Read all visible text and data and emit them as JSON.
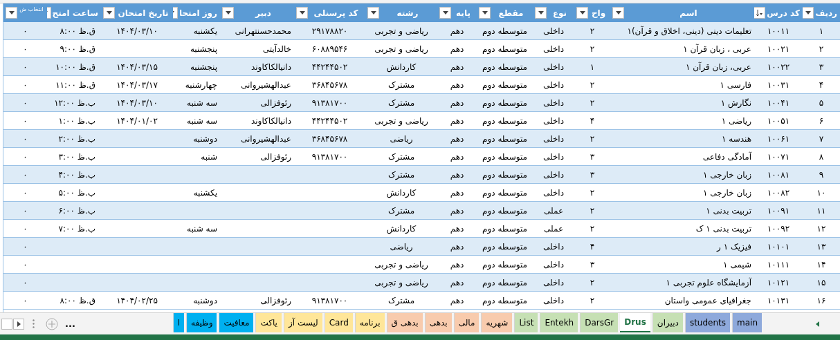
{
  "table": {
    "columns": [
      {
        "label": "ردیف",
        "sorted": false
      },
      {
        "label": "کد درس",
        "sorted": true
      },
      {
        "label": "اسم",
        "sorted": false
      },
      {
        "label": "واح",
        "sorted": false
      },
      {
        "label": "نوع",
        "sorted": false
      },
      {
        "label": "مقطع",
        "sorted": false
      },
      {
        "label": "پایه",
        "sorted": false
      },
      {
        "label": "رشته",
        "sorted": false
      },
      {
        "label": "کد پرسنلی",
        "sorted": false
      },
      {
        "label": "دبیر",
        "sorted": false
      },
      {
        "label": "روز امتحا",
        "sorted": false
      },
      {
        "label": "تاریخ امتحان",
        "sorted": false
      },
      {
        "label": "ساعت امتح",
        "sorted": false
      },
      {
        "label": "انتخاب ش",
        "sorted": false
      }
    ],
    "rows": [
      [
        "۱",
        "۱۰۰۱۱",
        "تعلیمات دینی (دینی، اخلاق و قرآن)۱",
        "۲",
        "داخلی",
        "متوسطه دوم",
        "دهم",
        "ریاضی و تجربی",
        "۲۹۱۷۸۸۲۰",
        "محمدحسنتهرانی",
        "یکشنبه",
        "۱۴۰۴/۰۳/۱۰",
        "ق.ظ ۸:۰۰",
        "۰"
      ],
      [
        "۲",
        "۱۰۰۲۱",
        "عربی ، زبان قرآن ۱",
        "۲",
        "داخلی",
        "متوسطه دوم",
        "دهم",
        "ریاضی و تجربی",
        "۶۰۸۸۹۵۴۶",
        "خالدآیتی",
        "پنجشنبه",
        null,
        "ق.ظ ۹:۰۰",
        "۰"
      ],
      [
        "۳",
        "۱۰۰۲۲",
        "عربی، زبان قرآن ۱",
        "۱",
        "داخلی",
        "متوسطه دوم",
        "دهم",
        "کاردانش",
        "۴۴۲۴۴۵۰۲",
        "دانیالکاکاوند",
        "پنجشنبه",
        "۱۴۰۴/۰۳/۱۵",
        "ق.ظ ۱۰:۰۰",
        "۰"
      ],
      [
        "۴",
        "۱۰۰۳۱",
        "فارسی ۱",
        "۲",
        "داخلی",
        "متوسطه دوم",
        "دهم",
        "مشترک",
        "۳۶۸۴۵۶۷۸",
        "عبدالهشیروانی",
        "چهارشنبه",
        "۱۴۰۴/۰۳/۱۷",
        "ق.ظ ۱۱:۰۰",
        "۰"
      ],
      [
        "۵",
        "۱۰۰۴۱",
        "نگارش ۱",
        "۲",
        "داخلی",
        "متوسطه دوم",
        "دهم",
        "مشترک",
        "۹۱۳۸۱۷۰۰",
        "رئوفزالی",
        "سه شنبه",
        "۱۴۰۴/۰۳/۱۰",
        "ب.ظ ۱۲:۰۰",
        "۰"
      ],
      [
        "۶",
        "۱۰۰۵۱",
        "ریاضی ۱",
        "۴",
        "داخلی",
        "متوسطه دوم",
        "دهم",
        "ریاضی و تجربی",
        "۴۴۲۴۴۵۰۲",
        "دانیالکاکاوند",
        "سه شنبه",
        "۱۴۰۴/۰۱/۰۲",
        "ب.ظ ۱:۰۰",
        "۰"
      ],
      [
        "۷",
        "۱۰۰۶۱",
        "هندسه ۱",
        "۲",
        "داخلی",
        "متوسطه دوم",
        "دهم",
        "ریاضی",
        "۳۶۸۴۵۶۷۸",
        "عبدالهشیروانی",
        "دوشنبه",
        null,
        "ب.ظ ۲:۰۰",
        "۰"
      ],
      [
        "۸",
        "۱۰۰۷۱",
        "آمادگی دفاعی",
        "۳",
        "داخلی",
        "متوسطه دوم",
        "دهم",
        "مشترک",
        "۹۱۳۸۱۷۰۰",
        "رئوفزالی",
        "شنبه",
        null,
        "ب.ظ ۳:۰۰",
        "۰"
      ],
      [
        "۹",
        "۱۰۰۸۱",
        "زبان خارجی ۱",
        "۳",
        "داخلی",
        "متوسطه دوم",
        "دهم",
        "مشترک",
        null,
        null,
        null,
        null,
        "ب.ظ ۴:۰۰",
        "۰"
      ],
      [
        "۱۰",
        "۱۰۰۸۲",
        "زبان خارجی ۱",
        "۲",
        "داخلی",
        "متوسطه دوم",
        "دهم",
        "کاردانش",
        null,
        null,
        "یکشنبه",
        null,
        "ب.ظ ۵:۰۰",
        "۰"
      ],
      [
        "۱۱",
        "۱۰۰۹۱",
        "تربیت بدنی ۱",
        "۲",
        "عملی",
        "متوسطه دوم",
        "دهم",
        "مشترک",
        null,
        null,
        null,
        null,
        "ب.ظ ۶:۰۰",
        "۰"
      ],
      [
        "۱۲",
        "۱۰۰۹۲",
        "تربیت بدنی ۱ ک",
        "۲",
        "عملی",
        "متوسطه دوم",
        "دهم",
        "کاردانش",
        null,
        null,
        "سه شنبه",
        null,
        "ب.ظ ۷:۰۰",
        "۰"
      ],
      [
        "۱۳",
        "۱۰۱۰۱",
        "فیزیک ۱ ر",
        "۴",
        "داخلی",
        "متوسطه دوم",
        "دهم",
        "ریاضی",
        null,
        null,
        null,
        null,
        null,
        "۰"
      ],
      [
        "۱۴",
        "۱۰۱۱۱",
        "شیمی ۱",
        "۳",
        "داخلی",
        "متوسطه دوم",
        "دهم",
        "ریاضی و تجربی",
        null,
        null,
        null,
        null,
        null,
        "۰"
      ],
      [
        "۱۵",
        "۱۰۱۲۱",
        "آزمایشگاه علوم تجربی ۱",
        "۲",
        "داخلی",
        "متوسطه دوم",
        "دهم",
        "ریاضی و تجربی",
        null,
        null,
        null,
        null,
        null,
        "۰"
      ],
      [
        "۱۶",
        "۱۰۱۳۱",
        "جغرافیای عمومی واستان",
        "۲",
        "داخلی",
        "متوسطه دوم",
        "دهم",
        "مشترک",
        "۹۱۳۸۱۷۰۰",
        "رئوفزالی",
        "دوشنبه",
        "۱۴۰۴/۰۲/۲۵",
        "ق.ظ ۸:۰۰",
        "۰"
      ]
    ]
  },
  "sheet_tabs": [
    {
      "label": "main",
      "selected": false,
      "color": "#8ea9db"
    },
    {
      "label": "students",
      "selected": false,
      "color": "#8ea9db"
    },
    {
      "label": "دبیران",
      "selected": false,
      "color": "#c6e0b4"
    },
    {
      "label": "Drus",
      "selected": true
    },
    {
      "label": "DarsGr",
      "selected": false,
      "color": "#c6e0b4"
    },
    {
      "label": "Entekh",
      "selected": false,
      "color": "#c6e0b4"
    },
    {
      "label": "List",
      "selected": false,
      "color": "#c6e0b4"
    },
    {
      "label": "شهریه",
      "selected": false,
      "color": "#f8cbad"
    },
    {
      "label": "مالی",
      "selected": false,
      "color": "#f8cbad"
    },
    {
      "label": "بدهی",
      "selected": false,
      "color": "#f8cbad"
    },
    {
      "label": "بدهی ق",
      "selected": false,
      "color": "#f8cbad"
    },
    {
      "label": "برنامه",
      "selected": false,
      "color": "#ffe699"
    },
    {
      "label": "Card",
      "selected": false,
      "color": "#ffe699"
    },
    {
      "label": "لیست آز",
      "selected": false,
      "color": "#ffe699"
    },
    {
      "label": "یاکت",
      "selected": false,
      "color": "#ffe699"
    },
    {
      "label": "معافیت",
      "selected": false,
      "color": "#00b0f0"
    },
    {
      "label": "وظیفه",
      "selected": false,
      "color": "#00b0f0"
    },
    {
      "label": "ا",
      "selected": false,
      "color": "#00b0f0"
    }
  ],
  "more_tabs": "..."
}
